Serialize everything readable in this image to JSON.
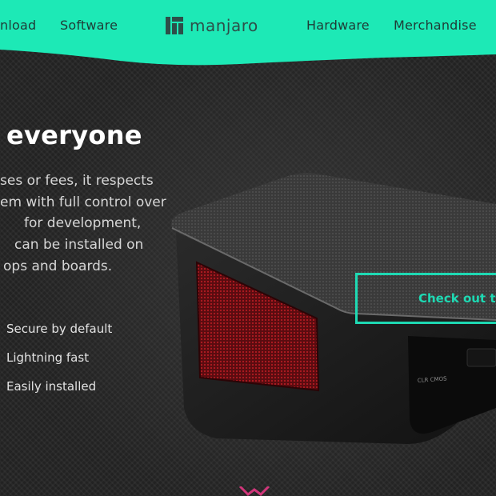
{
  "header": {
    "nav_left": [
      "nload",
      "Software"
    ],
    "logo_text": "manjaro",
    "nav_right": [
      "Hardware",
      "Merchandise"
    ]
  },
  "hero": {
    "headline": "everyone",
    "description_lines": [
      "ses or fees, it respects",
      "em with full control over",
      "for development,",
      "can be installed on",
      "ops and boards."
    ],
    "features": [
      "Secure by default",
      "Lightning fast",
      "Easily installed"
    ],
    "cta_label": "Check out th"
  },
  "colors": {
    "accent": "#1ed9b3",
    "header_bg": "#1de9b6",
    "background": "#1e1e1e"
  },
  "icons": {
    "logo": "manjaro-logo-icon",
    "bottom": "bottom-partial-icon"
  },
  "device_labels": [
    "CLR CMOS"
  ]
}
